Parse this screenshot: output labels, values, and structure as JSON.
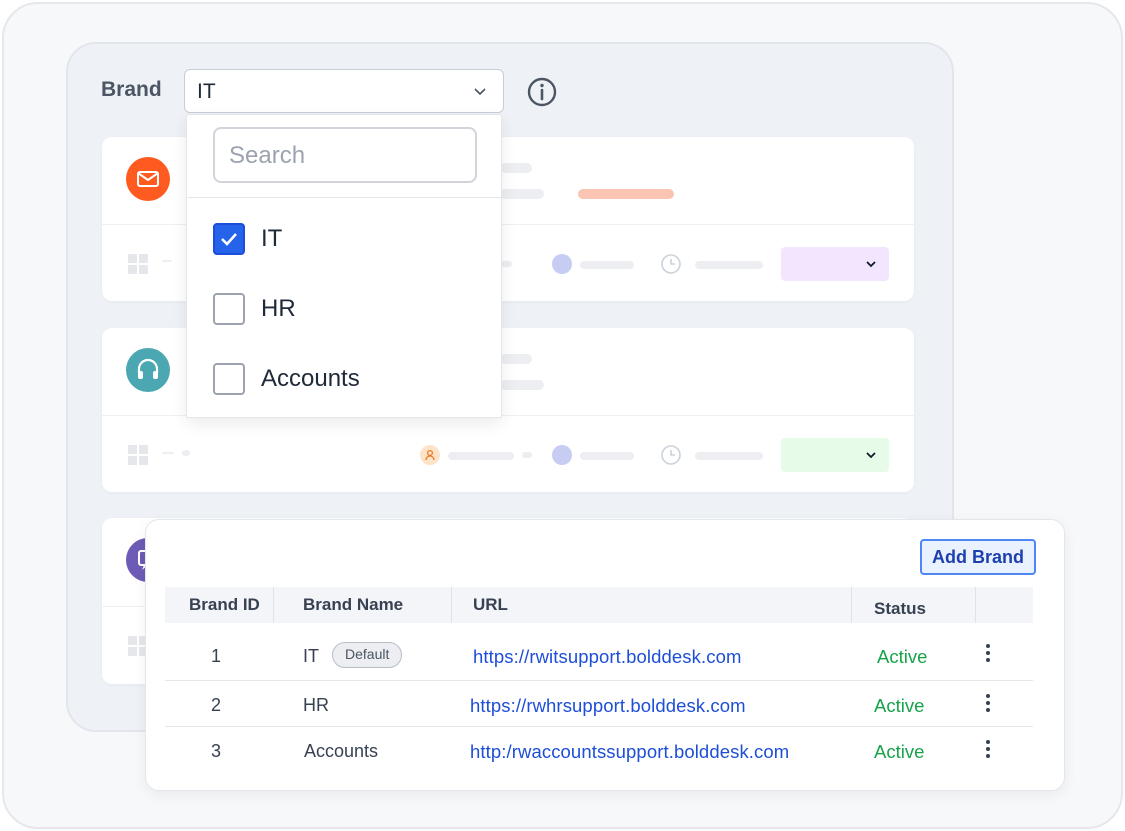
{
  "brand_filter": {
    "label": "Brand",
    "selected_value": "IT",
    "search_placeholder": "Search",
    "options": [
      {
        "label": "IT",
        "checked": true
      },
      {
        "label": "HR",
        "checked": false
      },
      {
        "label": "Accounts",
        "checked": false
      }
    ]
  },
  "ticket_cards": [
    {
      "channel_icon": "mail-icon",
      "icon_color": "#ff5a1f",
      "status_pill_color": "#f1e6fd"
    },
    {
      "channel_icon": "headset-icon",
      "icon_color": "#4ba8b2",
      "status_pill_color": "#e7fbe9"
    },
    {
      "channel_icon": "chat-icon",
      "icon_color": "#6d5bb6"
    }
  ],
  "brand_table": {
    "add_button_label": "Add Brand",
    "columns": [
      "Brand ID",
      "Brand Name",
      "URL",
      "Status"
    ],
    "rows": [
      {
        "id": "1",
        "name": "IT",
        "badge": "Default",
        "url": "https://rwitsupport.bolddesk.com",
        "status": "Active"
      },
      {
        "id": "2",
        "name": "HR",
        "url": "https://rwhrsupport.bolddesk.com",
        "status": "Active"
      },
      {
        "id": "3",
        "name": "Accounts",
        "url": "http:/rwaccountssupport.bolddesk.com",
        "status": "Active"
      }
    ]
  },
  "colors": {
    "accent": "#2563eb",
    "link": "#1d4ed8",
    "status_active": "#16a34a"
  }
}
